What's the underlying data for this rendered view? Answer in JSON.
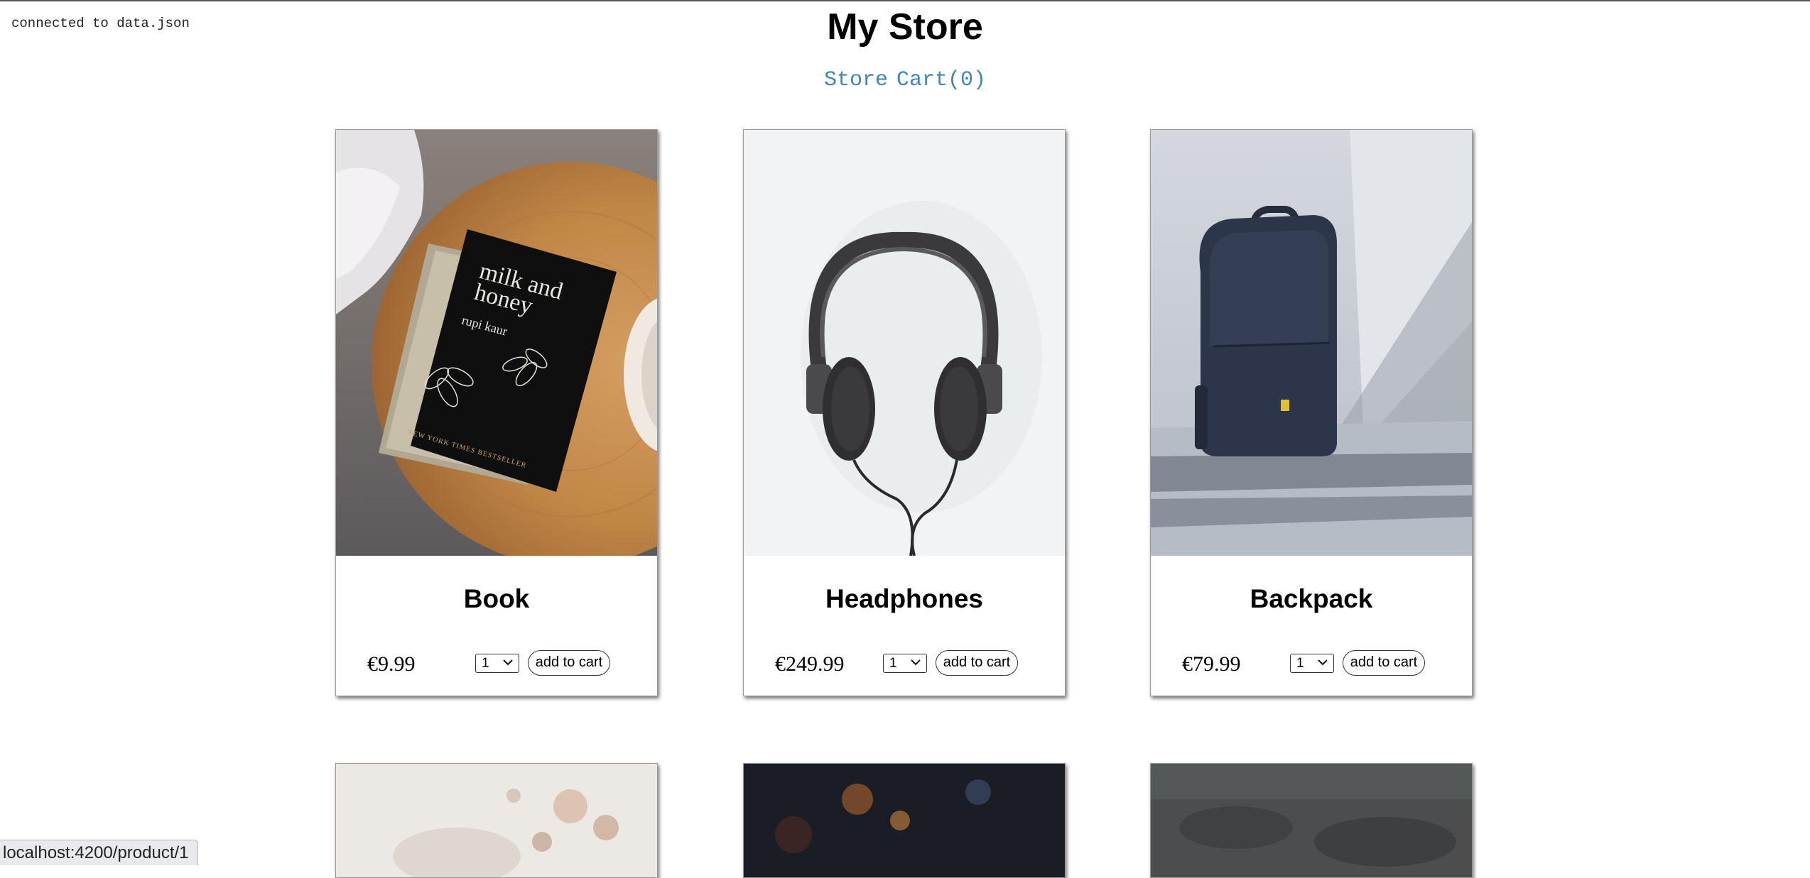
{
  "status": {
    "connection": "connected to data.json"
  },
  "header": {
    "title": "My Store"
  },
  "nav": {
    "store": "Store",
    "cart": "Cart(0)"
  },
  "products": [
    {
      "name": "Book",
      "price": "€9.99",
      "qty": "1",
      "add_label": "add to cart",
      "cover_title_1": "milk and",
      "cover_title_2": "honey",
      "cover_author": "rupi kaur",
      "cover_banner": "NEW YORK TIMES BESTSELLER"
    },
    {
      "name": "Headphones",
      "price": "€249.99",
      "qty": "1",
      "add_label": "add to cart"
    },
    {
      "name": "Backpack",
      "price": "€79.99",
      "qty": "1",
      "add_label": "add to cart"
    }
  ],
  "browser": {
    "status_url": "localhost:4200/product/1"
  }
}
